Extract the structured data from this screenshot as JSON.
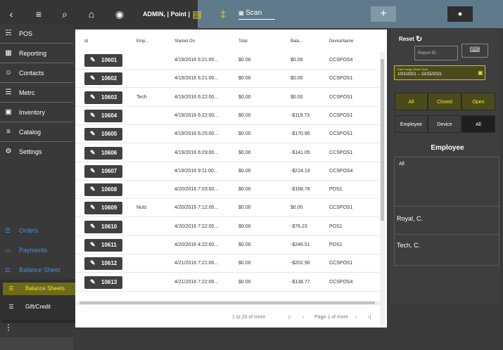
{
  "topbar": {
    "admin_label": "ADMIN, | Point |",
    "scan_label": "Scan",
    "icons": [
      "chevron-left-icon",
      "menu-collapse-icon",
      "search-icon",
      "home-icon",
      "location-icon",
      "register-icon",
      "utensils-icon",
      "qr-icon",
      "plus-icon",
      "user-icon"
    ]
  },
  "sidebar": {
    "items": [
      {
        "label": "POS",
        "icon": "cart-icon"
      },
      {
        "label": "Reporting",
        "icon": "dashboard-icon"
      },
      {
        "label": "Contacts",
        "icon": "contacts-icon"
      },
      {
        "label": "Metrc",
        "icon": "list-icon"
      },
      {
        "label": "Inventory",
        "icon": "archive-icon"
      },
      {
        "label": "Catalog",
        "icon": "catalog-icon"
      },
      {
        "label": "Settings",
        "icon": "gear-icon"
      }
    ],
    "blue_items": [
      {
        "label": "Orders",
        "icon": "list-icon"
      },
      {
        "label": "Payments",
        "icon": "card-icon"
      },
      {
        "label": "Balance Sheet",
        "icon": "scale-icon"
      }
    ],
    "submenu": [
      {
        "label": "Balance Sheets",
        "active": true
      },
      {
        "label": "Gift/Credit",
        "active": false
      }
    ],
    "accent_color": "#4a8ed6",
    "active_color": "#f2e52d"
  },
  "table": {
    "headers": [
      "Id",
      "Emp...",
      "Started On",
      "Total",
      "Bala...",
      "DeviceName"
    ],
    "rows": [
      {
        "id": "10601",
        "emp": "",
        "started": "4/19/2016 6:21:00...",
        "total": "$0.00",
        "balance": "$0.00",
        "device": "CCSPOS4"
      },
      {
        "id": "10602",
        "emp": "",
        "started": "4/19/2016 6:21:00...",
        "total": "$0.00",
        "balance": "$0.00",
        "device": "CCSPOS1"
      },
      {
        "id": "10603",
        "emp": "Tech",
        "started": "4/19/2016 6:22:00...",
        "total": "$0.00",
        "balance": "$0.00",
        "device": "CCSPOS1"
      },
      {
        "id": "10604",
        "emp": "",
        "started": "4/19/2016 6:22:00...",
        "total": "$0.00",
        "balance": "-$119.73",
        "device": "CCSPOS1"
      },
      {
        "id": "10605",
        "emp": "",
        "started": "4/19/2016 6:25:00...",
        "total": "$0.00",
        "balance": "-$170.90",
        "device": "CCSPOS1"
      },
      {
        "id": "10606",
        "emp": "",
        "started": "4/19/2016 6:29:00...",
        "total": "$0.00",
        "balance": "-$141.05",
        "device": "CCSPOS1"
      },
      {
        "id": "10607",
        "emp": "",
        "started": "4/19/2016 9:11:00...",
        "total": "$0.00",
        "balance": "-$214.19",
        "device": "CCSPOS4"
      },
      {
        "id": "10608",
        "emp": "",
        "started": "4/20/2016 7:03:00...",
        "total": "$0.00",
        "balance": "-$168.78",
        "device": "POS1"
      },
      {
        "id": "10609",
        "emp": "Nuts",
        "started": "4/20/2016 7:12:00...",
        "total": "$0.00",
        "balance": "$0.00",
        "device": "CCSPOS1"
      },
      {
        "id": "10610",
        "emp": "",
        "started": "4/20/2016 7:22:00...",
        "total": "$0.00",
        "balance": "-$76.23",
        "device": "POS1"
      },
      {
        "id": "10611",
        "emp": "",
        "started": "4/20/2016 4:22:00...",
        "total": "$0.00",
        "balance": "-$246.51",
        "device": "POS1"
      },
      {
        "id": "10612",
        "emp": "",
        "started": "4/21/2016 7:21:00...",
        "total": "$0.00",
        "balance": "-$202.90",
        "device": "CCSPOS1"
      },
      {
        "id": "10613",
        "emp": "",
        "started": "4/21/2016 7:22:00...",
        "total": "$0.00",
        "balance": "-$138.77",
        "device": "CCSPOS4"
      }
    ],
    "pager": {
      "range": "1 to 20 of more",
      "page": "Page 1 of more"
    }
  },
  "filters": {
    "reset_label": "Reset",
    "report_id_placeholder": "Report ID",
    "date_label": "Date Range (Start Time)",
    "date_value": "10/1/2021 – 10/15/2021",
    "status_options": [
      "All",
      "Closed",
      "Open"
    ],
    "type_options": [
      "Employee",
      "Device",
      "All"
    ],
    "employee_title": "Employee",
    "employees": [
      "All",
      "Royal, C.",
      "Tech, C."
    ]
  }
}
